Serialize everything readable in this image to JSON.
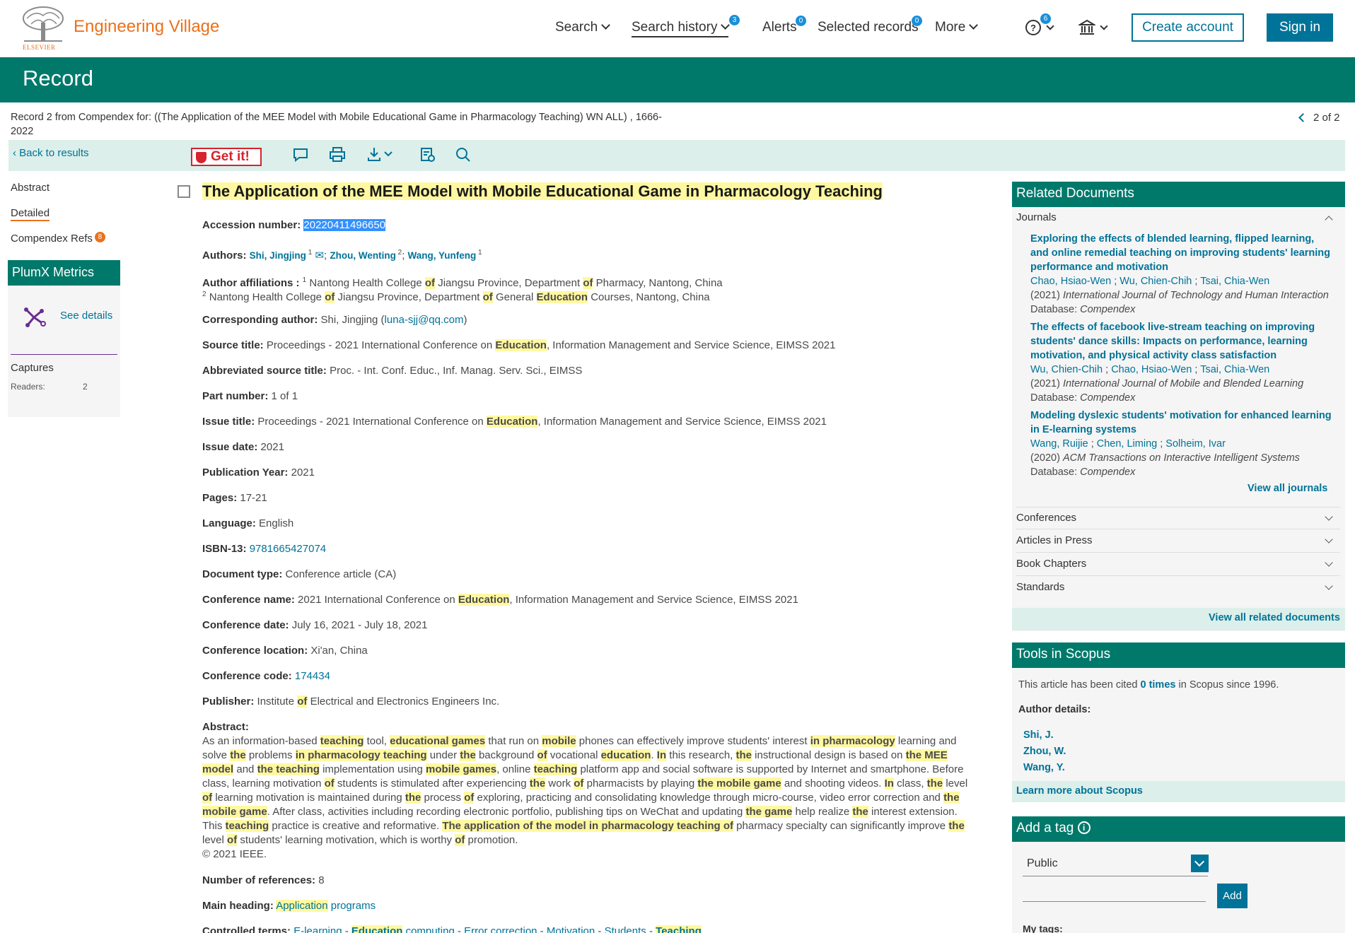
{
  "header": {
    "logo_text": "ELSEVIER",
    "brand": "Engineering Village",
    "nav": {
      "search": "Search",
      "search_history": "Search history",
      "search_history_count": "3",
      "alerts": "Alerts",
      "alerts_count": "0",
      "selected_records": "Selected records",
      "selected_count": "0",
      "more": "More",
      "help_count": "6"
    },
    "create_account": "Create account",
    "sign_in": "Sign in"
  },
  "record": {
    "heading": "Record",
    "info_line1": "Record 2 from Compendex for: ((The Application of the MEE Model with Mobile Educational Game in Pharmacology Teaching) WN ALL) , 1666-",
    "info_line2": "2022",
    "pager": "2 of 2"
  },
  "toolbar": {
    "back": "Back to results",
    "getit": "Get it!"
  },
  "left_nav": {
    "abstract": "Abstract",
    "detailed": "Detailed",
    "refs": "Compendex Refs",
    "refs_count": "8",
    "plumx_title": "PlumX Metrics",
    "see_details": "See details",
    "captures": "Captures",
    "readers_label": "Readers:",
    "readers_value": "2"
  },
  "article": {
    "title": "The Application of the MEE Model with Mobile Educational Game in Pharmacology Teaching",
    "accession_label": "Accession number:",
    "accession": "20220411496650",
    "authors_label": "Authors:",
    "author1": "Shi, Jingjing",
    "author2": "Zhou, Wenting",
    "author3": "Wang, Yunfeng",
    "affil_label": "Author affiliations :",
    "affil1_a": "Nantong Health College",
    "affil1_b": "Jiangsu Province, Department",
    "affil1_c": "Pharmacy, Nantong, China",
    "affil2_a": "Nantong Health College",
    "affil2_b": "Jiangsu Province, Department",
    "affil2_c": "General",
    "affil2_d": "Courses, Nantong, China",
    "corr_label": "Corresponding author:",
    "corr_name": "Shi, Jingjing (",
    "corr_email": "luna-sjj@qq.com",
    "corr_end": ")",
    "source_label": "Source title:",
    "source_a": "Proceedings - 2021 International Conference on",
    "source_b": ", Information Management and Service Science, EIMSS 2021",
    "abbr_label": "Abbreviated source title:",
    "abbr": "Proc. - Int. Conf. Educ., Inf. Manag. Serv. Sci., EIMSS",
    "part_label": "Part number:",
    "part": "1 of 1",
    "issue_label": "Issue title:",
    "issue_date_label": "Issue date:",
    "issue_date": "2021",
    "pubyear_label": "Publication Year:",
    "pubyear": "2021",
    "pages_label": "Pages:",
    "pages": "17-21",
    "lang_label": "Language:",
    "lang": "English",
    "isbn_label": "ISBN-13:",
    "isbn": "9781665427074",
    "doctype_label": "Document type:",
    "doctype": "Conference article (CA)",
    "confname_label": "Conference name:",
    "confname_a": "2021 International Conference on",
    "confdate_label": "Conference date:",
    "confdate": "July 16, 2021 - July 18, 2021",
    "confloc_label": "Conference location:",
    "confloc": "Xi'an, China",
    "confcode_label": "Conference code:",
    "confcode": "174434",
    "publisher_label": "Publisher:",
    "publisher_a": "Institute",
    "publisher_b": "Electrical and Electronics Engineers Inc.",
    "abstract_label": "Abstract:",
    "copyright": "© 2021 IEEE.",
    "numrefs_label": "Number of references:",
    "numrefs": "8",
    "mainhead_label": "Main heading:",
    "mainhead_b": "programs",
    "controlled_label": "Controlled terms:",
    "ct1": "E-learning",
    "ct2a": "Education",
    "ct2b": "computing",
    "ct3": "Error correction",
    "ct4": "Motivation",
    "ct5": "Students",
    "ct6": "Teaching"
  },
  "hl": {
    "of": "of",
    "education": "Education",
    "application": "Application"
  },
  "related": {
    "title": "Related Documents",
    "journals": "Journals",
    "doc1_title": "Exploring the effects of blended learning, flipped learning, and online remedial teaching on improving students' learning performance and motivation",
    "doc1_a1": "Chao, Hsiao-Wen",
    "doc1_a2": "Wu, Chien-Chih",
    "doc1_a3": "Tsai, Chia-Wen",
    "doc1_year": "(2021)",
    "doc1_journal": "International Journal of Technology and Human Interaction",
    "doc2_title": "The effects of facebook live-stream teaching on improving students' dance skills: Impacts on performance, learning motivation, and physical activity class satisfaction",
    "doc2_a1": "Wu, Chien-Chih",
    "doc2_a2": "Chao, Hsiao-Wen",
    "doc2_a3": "Tsai, Chia-Wen",
    "doc2_year": "(2021)",
    "doc2_journal": "International Journal of Mobile and Blended Learning",
    "doc3_title": "Modeling dyslexic students' motivation for enhanced learning in E-learning systems",
    "doc3_a1": "Wang, Ruijie",
    "doc3_a2": "Chen, Liming",
    "doc3_a3": "Solheim, Ivar",
    "doc3_year": "(2020)",
    "doc3_journal": "ACM Transactions on Interactive Intelligent Systems",
    "db_label": "Database:",
    "db": "Compendex",
    "view_journals": "View all journals",
    "conferences": "Conferences",
    "articles_press": "Articles in Press",
    "book_chapters": "Book Chapters",
    "standards": "Standards",
    "view_all": "View all related documents"
  },
  "scopus": {
    "title": "Tools in Scopus",
    "cited_a": "This article has been cited",
    "cited_times": "0 times",
    "cited_b": "in Scopus since 1996.",
    "author_details": "Author details:",
    "a1": "Shi, J.",
    "a2": "Zhou, W.",
    "a3": "Wang, Y.",
    "learn_more": "Learn more about Scopus"
  },
  "tag": {
    "title": "Add a tag",
    "visibility": "Public",
    "add": "Add",
    "my_tags": "My tags:"
  },
  "colors": {
    "brand_orange": "#e9711c",
    "teal": "#00796b",
    "link": "#007398",
    "highlight": "#fff8a0"
  }
}
